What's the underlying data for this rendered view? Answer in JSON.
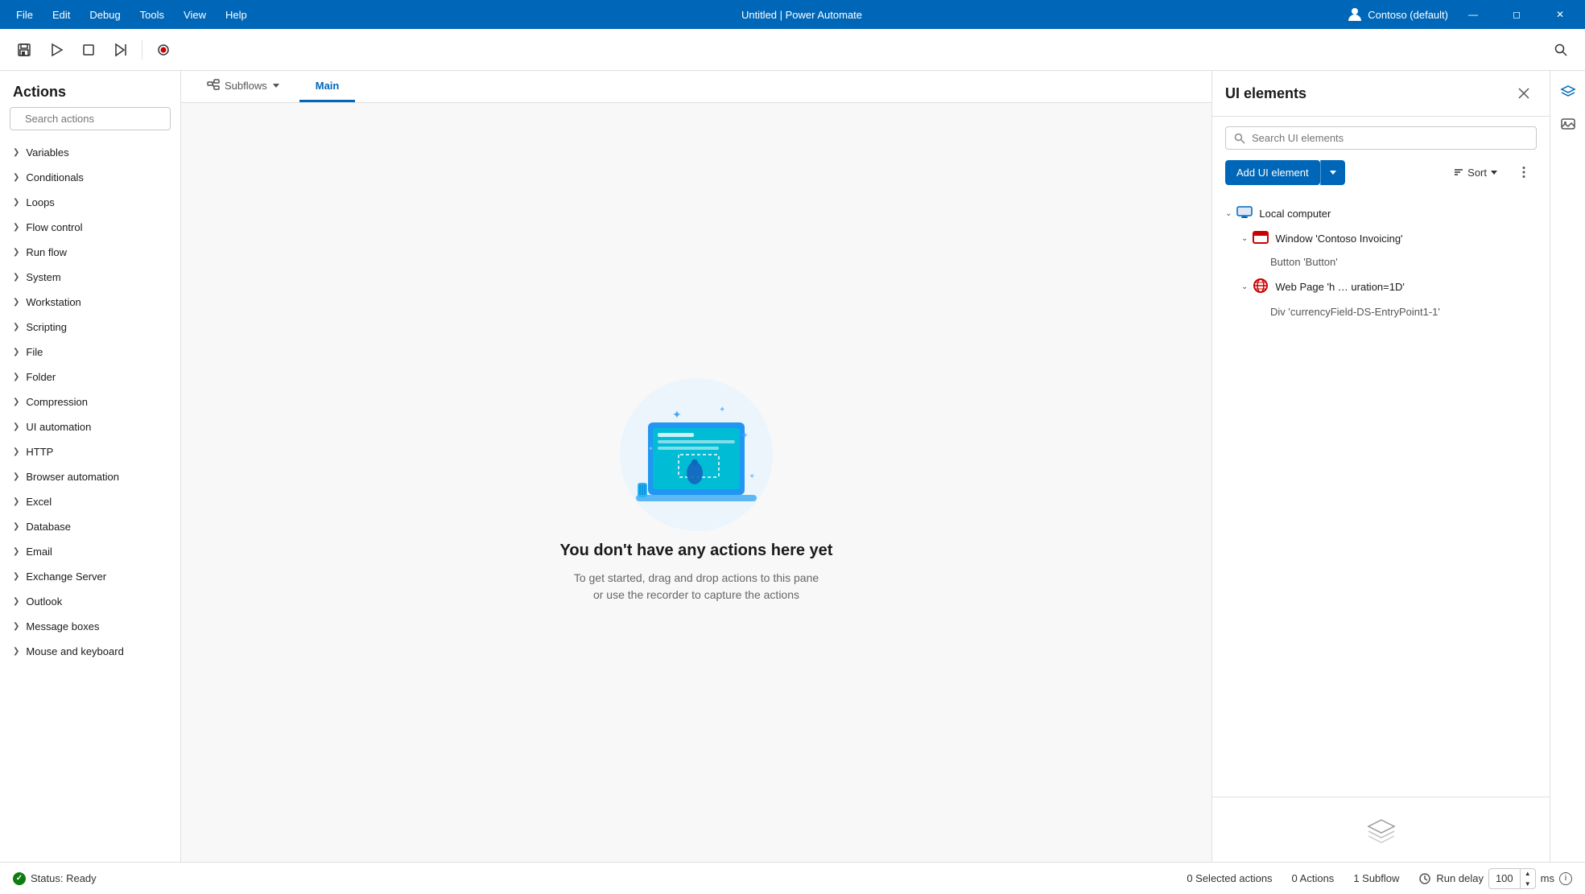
{
  "titleBar": {
    "menu": [
      "File",
      "Edit",
      "Debug",
      "Tools",
      "View",
      "Help"
    ],
    "title": "Untitled | Power Automate",
    "account": "Contoso (default)",
    "controls": [
      "minimize",
      "maximize",
      "close"
    ]
  },
  "toolbar": {
    "save_title": "Save",
    "play_title": "Run",
    "stop_title": "Stop",
    "next_title": "Run next action",
    "record_title": "Record"
  },
  "actionsPanel": {
    "title": "Actions",
    "search_placeholder": "Search actions",
    "items": [
      "Variables",
      "Conditionals",
      "Loops",
      "Flow control",
      "Run flow",
      "System",
      "Workstation",
      "Scripting",
      "File",
      "Folder",
      "Compression",
      "UI automation",
      "HTTP",
      "Browser automation",
      "Excel",
      "Database",
      "Email",
      "Exchange Server",
      "Outlook",
      "Message boxes",
      "Mouse and keyboard"
    ]
  },
  "canvas": {
    "tabs": [
      {
        "label": "Subflows",
        "type": "dropdown",
        "active": false
      },
      {
        "label": "Main",
        "active": true
      }
    ],
    "emptyState": {
      "title": "You don't have any actions here yet",
      "description": "To get started, drag and drop actions to this pane\nor use the recorder to capture the actions"
    }
  },
  "uiElementsPanel": {
    "title": "UI elements",
    "search_placeholder": "Search UI elements",
    "addButton": "Add UI element",
    "sortLabel": "Sort",
    "treeItems": [
      {
        "level": 0,
        "type": "group",
        "icon": "monitor",
        "label": "Local computer",
        "expanded": true
      },
      {
        "level": 1,
        "type": "window",
        "icon": "window",
        "label": "Window 'Contoso Invoicing'",
        "expanded": true
      },
      {
        "level": 2,
        "type": "child",
        "label": "Button 'Button'"
      },
      {
        "level": 1,
        "type": "webpage",
        "icon": "globe",
        "label": "Web Page 'h … uration=1D'",
        "expanded": true
      },
      {
        "level": 2,
        "type": "child",
        "label": "Div 'currencyField-DS-EntryPoint1-1'"
      }
    ]
  },
  "statusBar": {
    "status": "Status: Ready",
    "selectedActions": "0 Selected actions",
    "actions": "0 Actions",
    "subflow": "1 Subflow",
    "runDelayLabel": "Run delay",
    "runDelayValue": "100",
    "runDelayUnit": "ms"
  }
}
